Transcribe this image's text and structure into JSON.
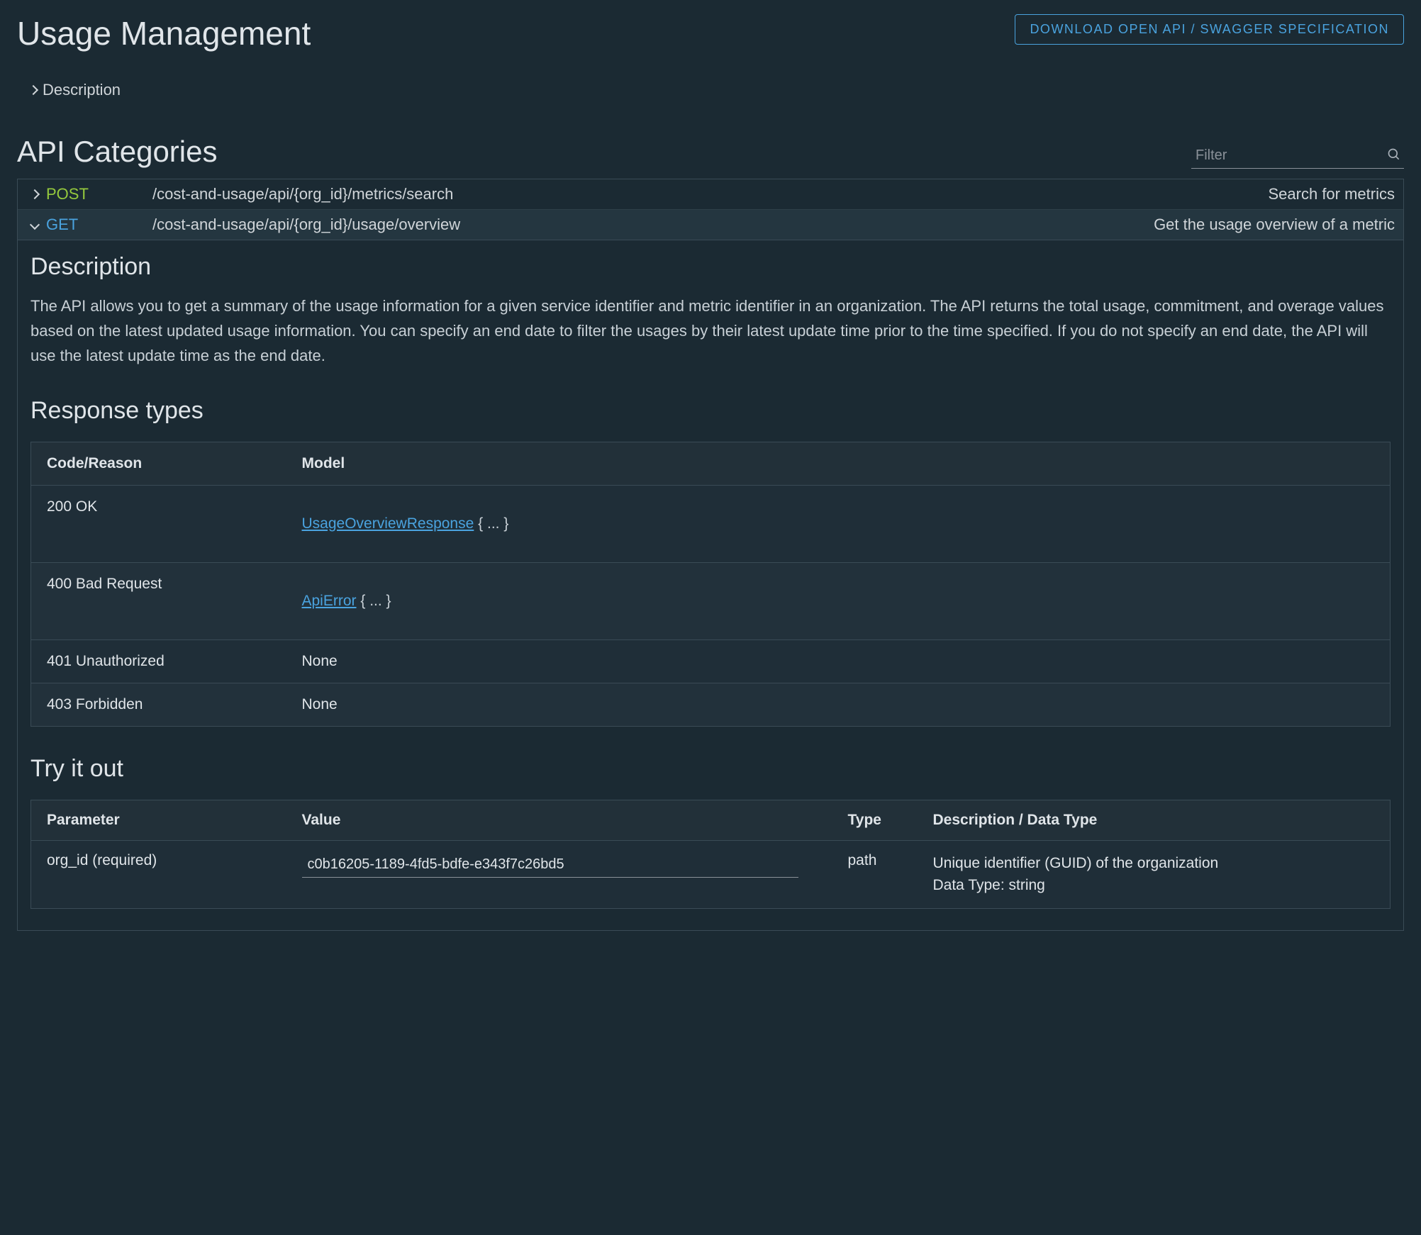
{
  "header": {
    "title": "Usage Management",
    "download_button": "DOWNLOAD OPEN API / SWAGGER SPECIFICATION"
  },
  "description_toggle": {
    "label": "Description"
  },
  "categories": {
    "title": "API Categories",
    "filter_placeholder": "Filter"
  },
  "endpoints": [
    {
      "method": "POST",
      "method_class": "method-post",
      "path": "/cost-and-usage/api/{org_id}/metrics/search",
      "summary": "Search for metrics",
      "expanded": false
    },
    {
      "method": "GET",
      "method_class": "method-get",
      "path": "/cost-and-usage/api/{org_id}/usage/overview",
      "summary": "Get the usage overview of a metric",
      "expanded": true
    }
  ],
  "detail": {
    "desc_heading": "Description",
    "desc_text": "The API allows you to get a summary of the usage information for a given service identifier and metric identifier in an organization. The API returns the total usage, commitment, and overage values based on the latest updated usage information. You can specify an end date to filter the usages by their latest update time prior to the time specified. If you do not specify an end date, the API will use the latest update time as the end date.",
    "response_heading": "Response types",
    "response_headers": {
      "code": "Code/Reason",
      "model": "Model"
    },
    "responses": [
      {
        "code": "200 OK",
        "model": "UsageOverviewResponse",
        "suffix": " { ... }"
      },
      {
        "code": "400 Bad Request",
        "model": "ApiError",
        "suffix": " { ... }"
      },
      {
        "code": "401 Unauthorized",
        "model_plain": "None"
      },
      {
        "code": "403 Forbidden",
        "model_plain": "None"
      }
    ],
    "try_heading": "Try it out",
    "try_headers": {
      "param": "Parameter",
      "value": "Value",
      "type": "Type",
      "desc": "Description / Data Type"
    },
    "try_rows": [
      {
        "param": "org_id (required)",
        "value": "c0b16205-1189-4fd5-bdfe-e343f7c26bd5",
        "type": "path",
        "desc_line1": "Unique identifier (GUID) of the organization",
        "desc_line2": "Data Type: string"
      }
    ]
  }
}
